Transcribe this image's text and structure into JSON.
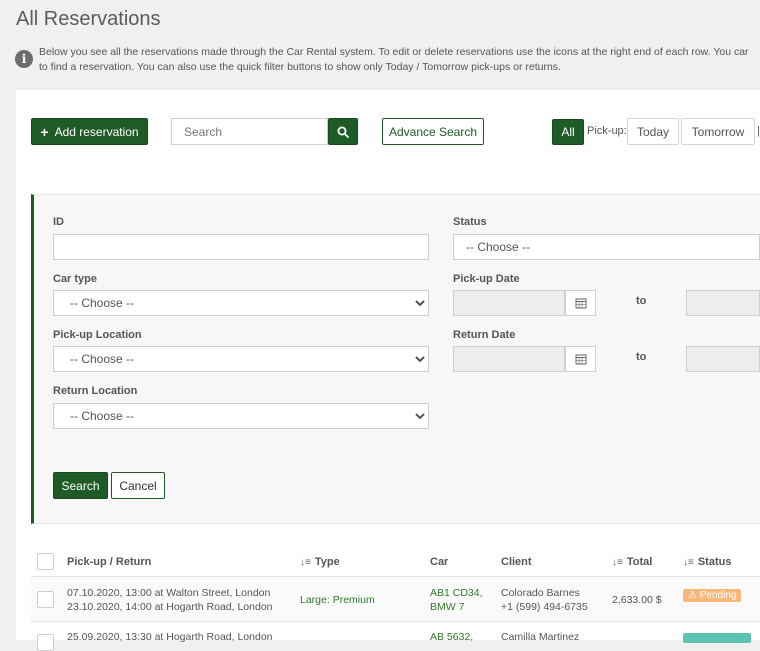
{
  "header": {
    "title": "All Reservations",
    "info_line1": "Below you see all the reservations made through the Car Rental system. To edit or delete reservations use the icons at the right end of each row. You car",
    "info_line2": "to find a reservation. You can also use the quick filter buttons to show only Today / Tomorrow pick-ups or returns."
  },
  "toolbar": {
    "add_label": "Add reservation",
    "search_placeholder": "Search",
    "advance_search_label": "Advance Search",
    "all_label": "All",
    "pickup_label": "Pick-up:",
    "today_label": "Today",
    "tomorrow_label": "Tomorrow"
  },
  "filters": {
    "id_label": "ID",
    "status_label": "Status",
    "status_value": "-- Choose --",
    "car_type_label": "Car type",
    "car_type_value": "-- Choose --",
    "pickup_date_label": "Pick-up Date",
    "pickup_location_label": "Pick-up Location",
    "pickup_location_value": "-- Choose --",
    "return_date_label": "Return Date",
    "return_location_label": "Return Location",
    "return_location_value": "-- Choose --",
    "to_label": "to",
    "search_label": "Search",
    "cancel_label": "Cancel"
  },
  "table": {
    "columns": [
      "Pick-up / Return",
      "Type",
      "Car",
      "Client",
      "Total",
      "Status"
    ],
    "rows": [
      {
        "pickup": "07.10.2020, 13:00 at Walton Street, London",
        "return": "23.10.2020, 14:00 at Hogarth Road, London",
        "type": "Large: Premium",
        "car1": "AB1 CD34,",
        "car2": "BMW 7",
        "client_name": "Colorado Barnes",
        "client_phone": "+1 (599) 494-6735",
        "total": "2,633.00 $",
        "status": "Pending",
        "status_color": "#f7b87a"
      },
      {
        "pickup": "25.09.2020, 13:30 at Hogarth Road, London",
        "car1": "AB 5632,",
        "client_name": "Camilla Martinez",
        "status_color": "#5cc4b5"
      }
    ]
  },
  "colors": {
    "accent": "#1e5b27",
    "link": "#2f7a2a"
  }
}
